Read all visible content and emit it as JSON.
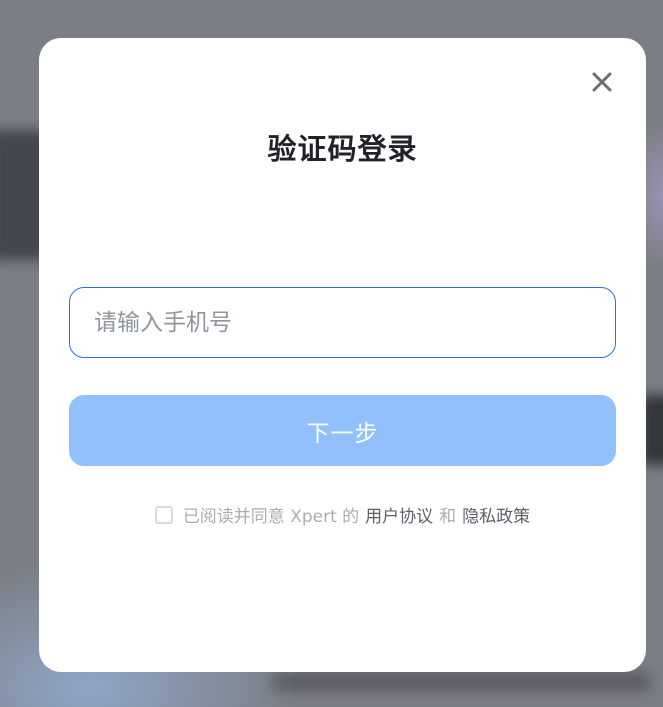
{
  "dialog": {
    "title": "验证码登录",
    "close_icon": "close-icon"
  },
  "phone": {
    "placeholder": "请输入手机号",
    "value": ""
  },
  "next_button": {
    "label": "下一步",
    "color": "#91c0fd"
  },
  "agreement": {
    "checked": false,
    "prefix": "已阅读并同意 Xpert 的",
    "user_agreement": "用户协议",
    "and": "和",
    "privacy_policy": "隐私政策"
  },
  "colors": {
    "input_border": "#2f6fd9",
    "title_text": "#1f2329",
    "muted_text": "#a9adb3",
    "link_text": "#5c6168"
  }
}
